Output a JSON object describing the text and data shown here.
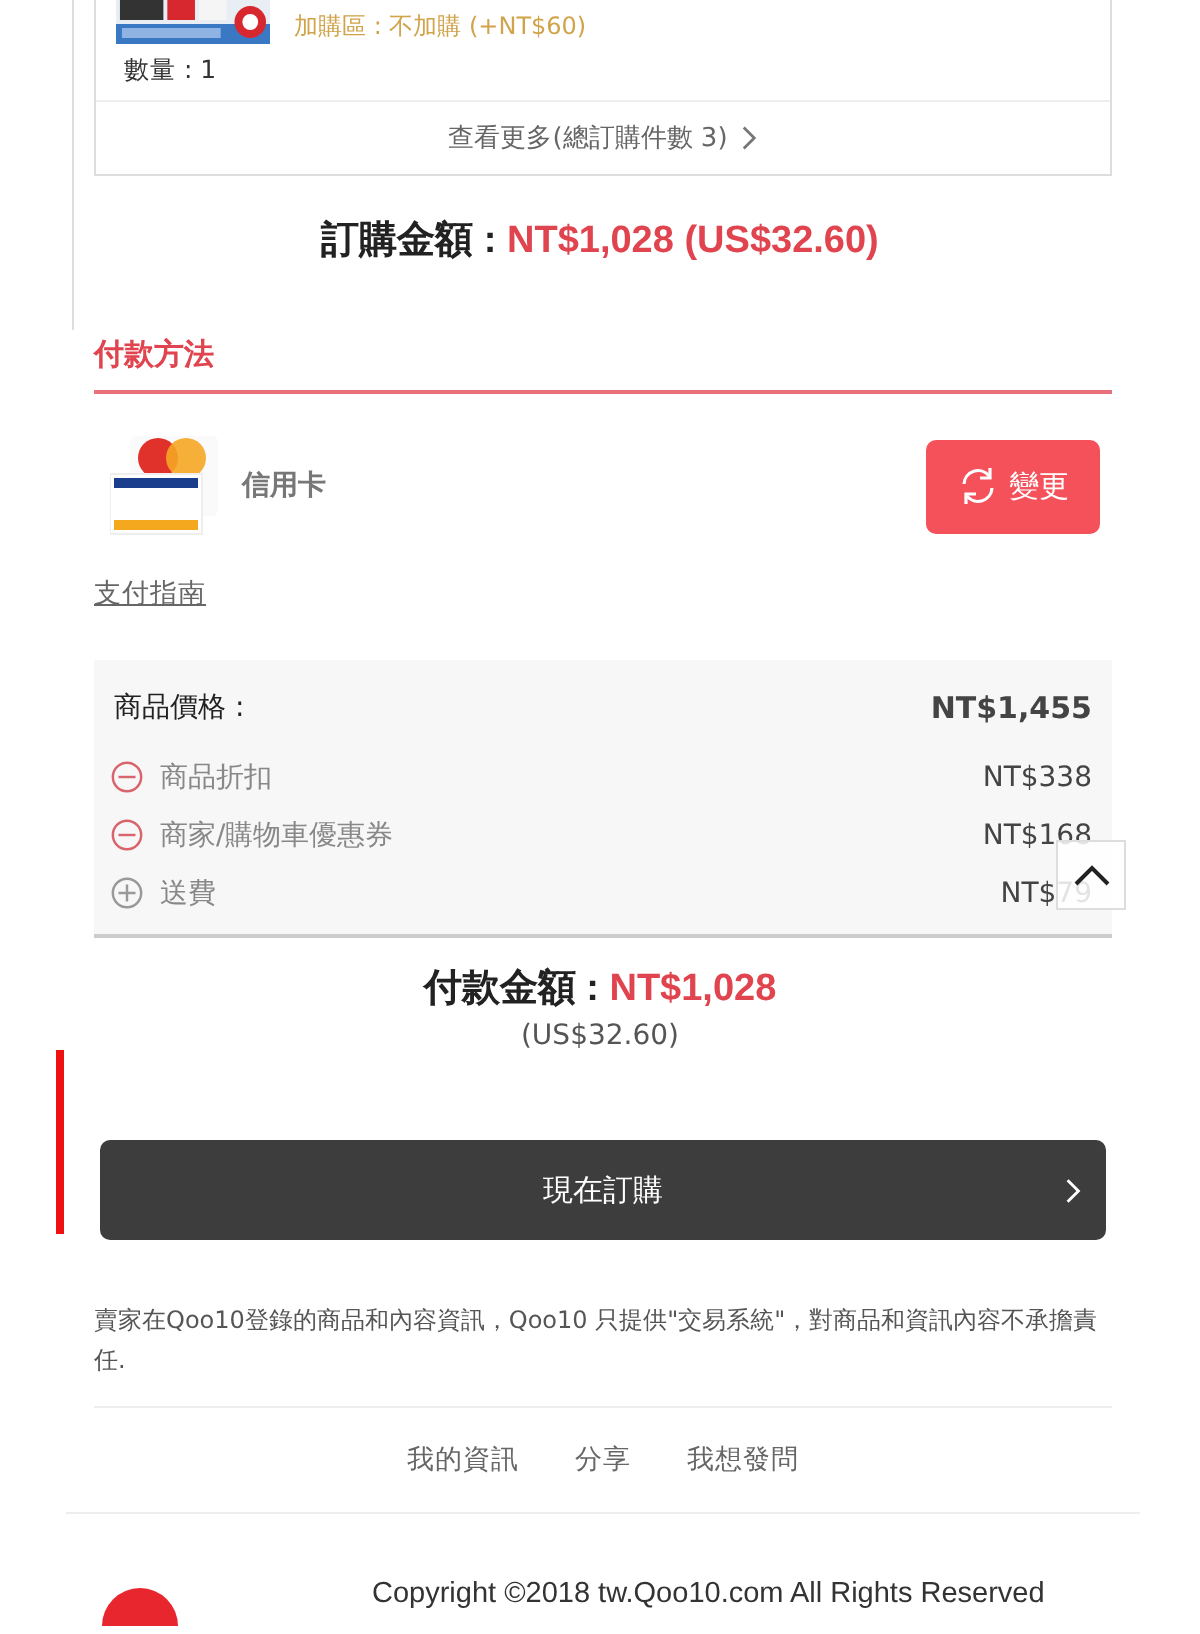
{
  "product_card": {
    "option_line": "加購區 : 不加購 (+NT$60)",
    "quantity": "數量 : 1",
    "more_link": "查看更多(總訂購件數 3)"
  },
  "order_total": {
    "label": "訂購金額 : ",
    "amount": "NT$1,028 (US$32.60)"
  },
  "payment": {
    "title": "付款方法",
    "method": "信用卡",
    "change_button": "變更",
    "guide_link": "支付指南"
  },
  "summary": {
    "rows": [
      {
        "kind": "total",
        "label": "商品價格 :",
        "value": "NT$1,455"
      },
      {
        "kind": "minus",
        "label": "商品折扣",
        "value": "NT$338"
      },
      {
        "kind": "minus",
        "label": "商家/購物車優惠券",
        "value": "NT$168"
      },
      {
        "kind": "plus",
        "label": "送費",
        "value": "NT$79"
      }
    ]
  },
  "payment_total": {
    "label": "付款金額 : ",
    "amount": "NT$1,028",
    "usd": "(US$32.60)"
  },
  "order_button": "現在訂購",
  "disclaimer": "賣家在Qoo10登錄的商品和內容資訊，Qoo10 只提供\"交易系統\"，對商品和資訊內容不承擔責任.",
  "footer_links": [
    "我的資訊",
    "分享",
    "我想發問"
  ],
  "copyright": "Copyright ©2018 tw.Qoo10.com All Rights Reserved"
}
